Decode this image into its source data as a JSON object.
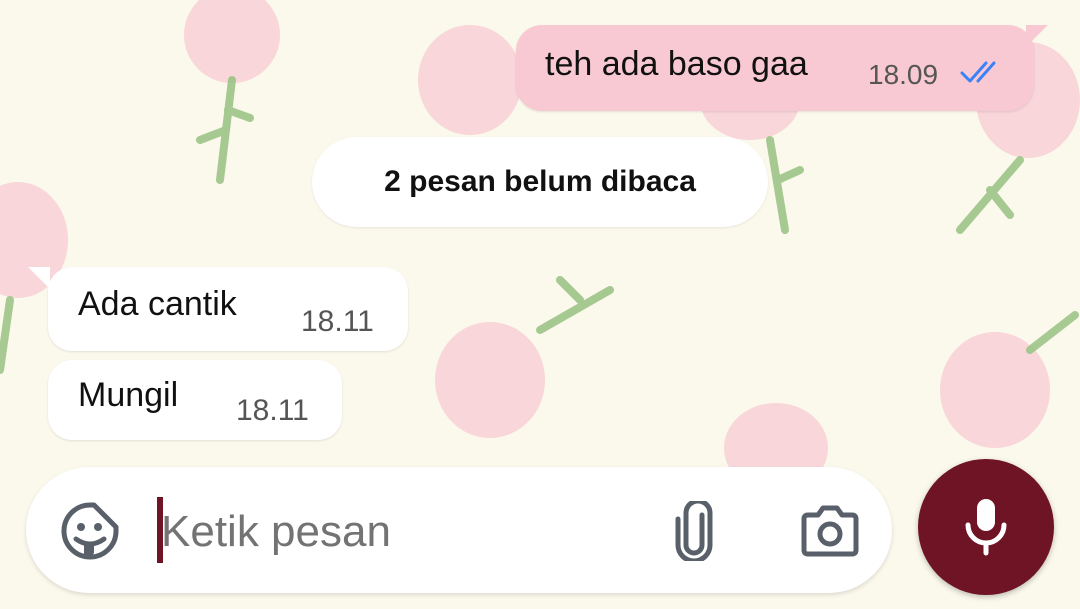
{
  "messages": [
    {
      "direction": "outgoing",
      "text": "teh ada baso gaa",
      "time": "18.09",
      "status": "read-double-check"
    },
    {
      "direction": "incoming",
      "text": "Ada cantik",
      "time": "18.11"
    },
    {
      "direction": "incoming",
      "text": "Mungil",
      "time": "18.11"
    }
  ],
  "unread_divider": {
    "label": "2 pesan belum dibaca"
  },
  "composer": {
    "placeholder": "Ketik pesan",
    "icons": {
      "sticker": "sticker-icon",
      "attach": "paperclip-icon",
      "camera": "camera-icon"
    }
  },
  "mic_button": {
    "icon": "microphone-icon"
  },
  "colors": {
    "accent": "#6e1424",
    "outgoing_bubble": "#f9c9d3",
    "incoming_bubble": "#ffffff",
    "read_ticks": "#3b82f6",
    "wallpaper": "#fbf8ec"
  }
}
